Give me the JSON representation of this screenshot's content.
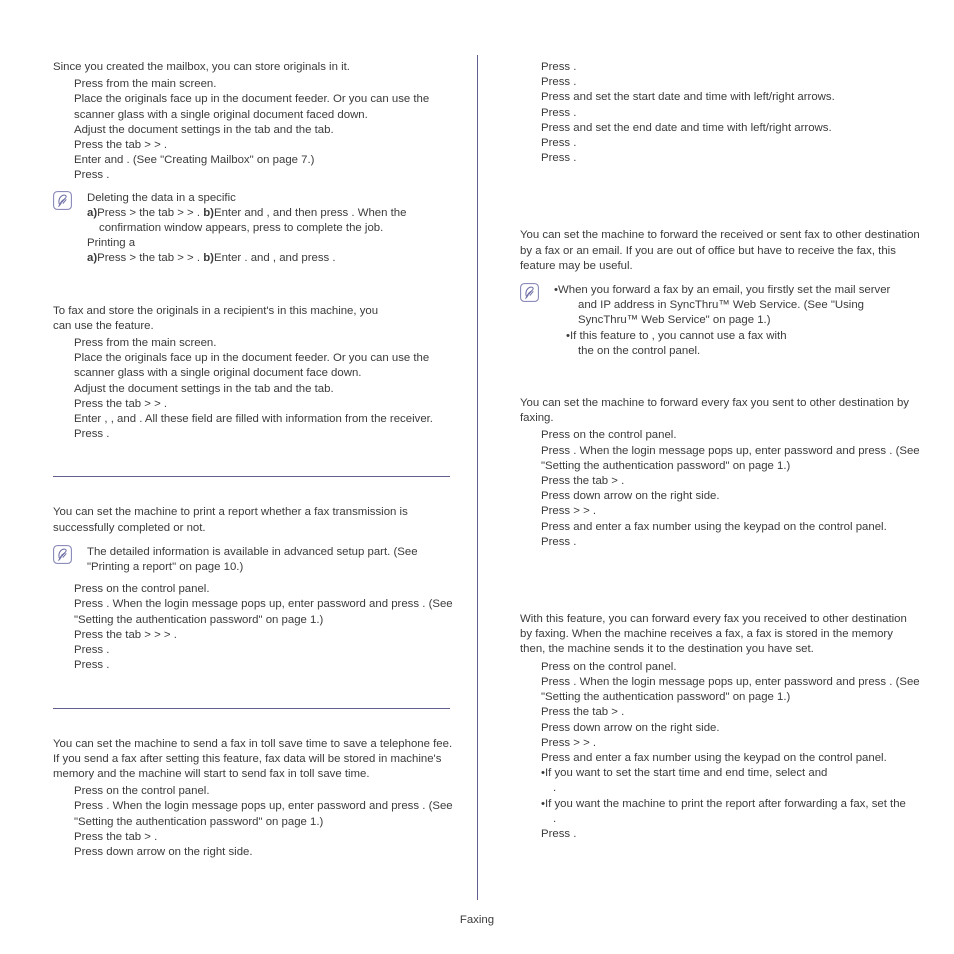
{
  "document": {
    "footer_label": "Faxing",
    "rule_color": "#60608f",
    "text_color": "#3b3b3b",
    "note_icon_name": "note-pen-icon"
  },
  "left_column": {
    "mailbox_store": {
      "intro": "Since you created the mailbox, you can store originals in it.",
      "steps": [
        "Press          from the main screen.",
        "Place the originals face up in the document feeder. Or you can use the scanner glass with a single original document faced down.",
        "Adjust the document settings in the             tab and the           tab.",
        "Press the                     tab >              >          .",
        "Enter                     and                    . (See \"Creating Mailbox\" on page 7.)",
        "Press         ."
      ]
    },
    "mailbox_note": {
      "line1": "Deleting the data in a specific",
      "a1_letter": "a)",
      "a1_text": "Press          > the                    tab >                 >             .",
      "b1_letter": "b)",
      "b1_text": "Enter                     and                       , and then press           . When the",
      "b1_cont": "confirmation window appears, press             to complete the job.",
      "line2": "Printing a",
      "a2_letter": "a)",
      "a2_text": "Press          > the                    tab >                 >          .",
      "b2_letter": "b)",
      "b2_text": "Enter                     . and                    , and press            ."
    },
    "remote_fax": {
      "intro_a": "To fax and store the originals in a recipient's                    in this machine, you",
      "intro_b": "can use the                                feature.",
      "steps": [
        "Press          from the main screen.",
        "Place the originals face up in the document feeder. Or you can use the scanner glass with a single original document face down.",
        "Adjust the document settings in the             tab and the           tab.",
        "Press the                     tab >              >                     .",
        "Enter                    ,                       , and                       . All these field are filled with information from the receiver.",
        "Press         ."
      ]
    },
    "report_section": {
      "intro": "You can set the machine to print a report whether a fax transmission is successfully completed or not.",
      "note": "The detailed information is available in advanced setup part. (See \"Printing a report\" on page 10.)",
      "steps": [
        "Press                         on the control panel.",
        "Press                      . When the login message pops up, enter password and press        . (See \"Setting the authentication password\" on page 1.)",
        "Press the                     tab >             >                    >                            .",
        "Press         .",
        " Press         ."
      ]
    },
    "toll_save_section": {
      "intro": "You can set the machine to send a fax in toll save time to save a telephone fee. If you send a fax after setting this feature, fax data will be stored in machine's memory and the machine will start to send fax in toll save time.",
      "steps": [
        "Press                         on the control panel.",
        "Press                      . When the login message pops up, enter password and press        . (See \"Setting the authentication password\" on page 1.)",
        "Press the             tab >                   .",
        "Press down arrow on the right side."
      ]
    }
  },
  "right_column": {
    "toll_save_continued": {
      "steps": [
        "Press                    .",
        "Press         .",
        "Press                         and set the start date and time with left/right arrows.",
        "Press         .",
        "Press                     and set the end date and time with left/right arrows.",
        "Press         .",
        "Press         ."
      ]
    },
    "forward_section": {
      "intro": "You can set the machine to forward the received or sent fax to other destination by a fax or an email. If you are out of office but have to receive the fax, this feature may be useful.",
      "note_bullet_1a": "•When you forward a fax by an email, you firstly set the mail server",
      "note_bullet_1b": "and IP address in SyncThru™ Web Service. (See \"Using",
      "note_bullet_1c": "SyncThru™ Web Service\" on page 1.)",
      "note_bullet_2a": "•If this                            feature to       , you cannot use a fax with",
      "note_bullet_2b": "the                          on the control panel."
    },
    "forward_send_section": {
      "intro": "You can set the machine to forward every fax you sent to other destination by faxing.",
      "steps": [
        "Press                      on the control panel.",
        "Press                      . When the login message pops up, enter password and press        . (See \"Setting the authentication password\" on page 1.)",
        "Press the             tab >                 .",
        "Press down arrow on the right side.",
        "Press                               >                                >                 .",
        "Press          and enter a fax number using the keypad on the control panel.",
        "Press         ."
      ]
    },
    "forward_receive_section": {
      "intro": "With this feature, you can forward every fax you received to other destination by faxing. When the machine receives a fax, a fax is stored in the memory then, the machine sends it to the destination you have set.",
      "steps": [
        "Press                      on the control panel.",
        "Press                      . When the login message pops up, enter password and press        . (See \"Setting the authentication password\" on page 1.)",
        "Press the             tab >                 .",
        "Press down arrow on the right side.",
        "Press                               >                                >                 .",
        "Press                   and enter a fax number using the keypad on the control panel."
      ],
      "bullet_1a": "•If you want to set the start time and end time, select                      and",
      "bullet_1b": "                            .",
      "bullet_2a": "•If you want the machine to print the report after forwarding a fax, set the",
      "bullet_2b": "                                  .",
      "final_step": "Press         ."
    }
  }
}
